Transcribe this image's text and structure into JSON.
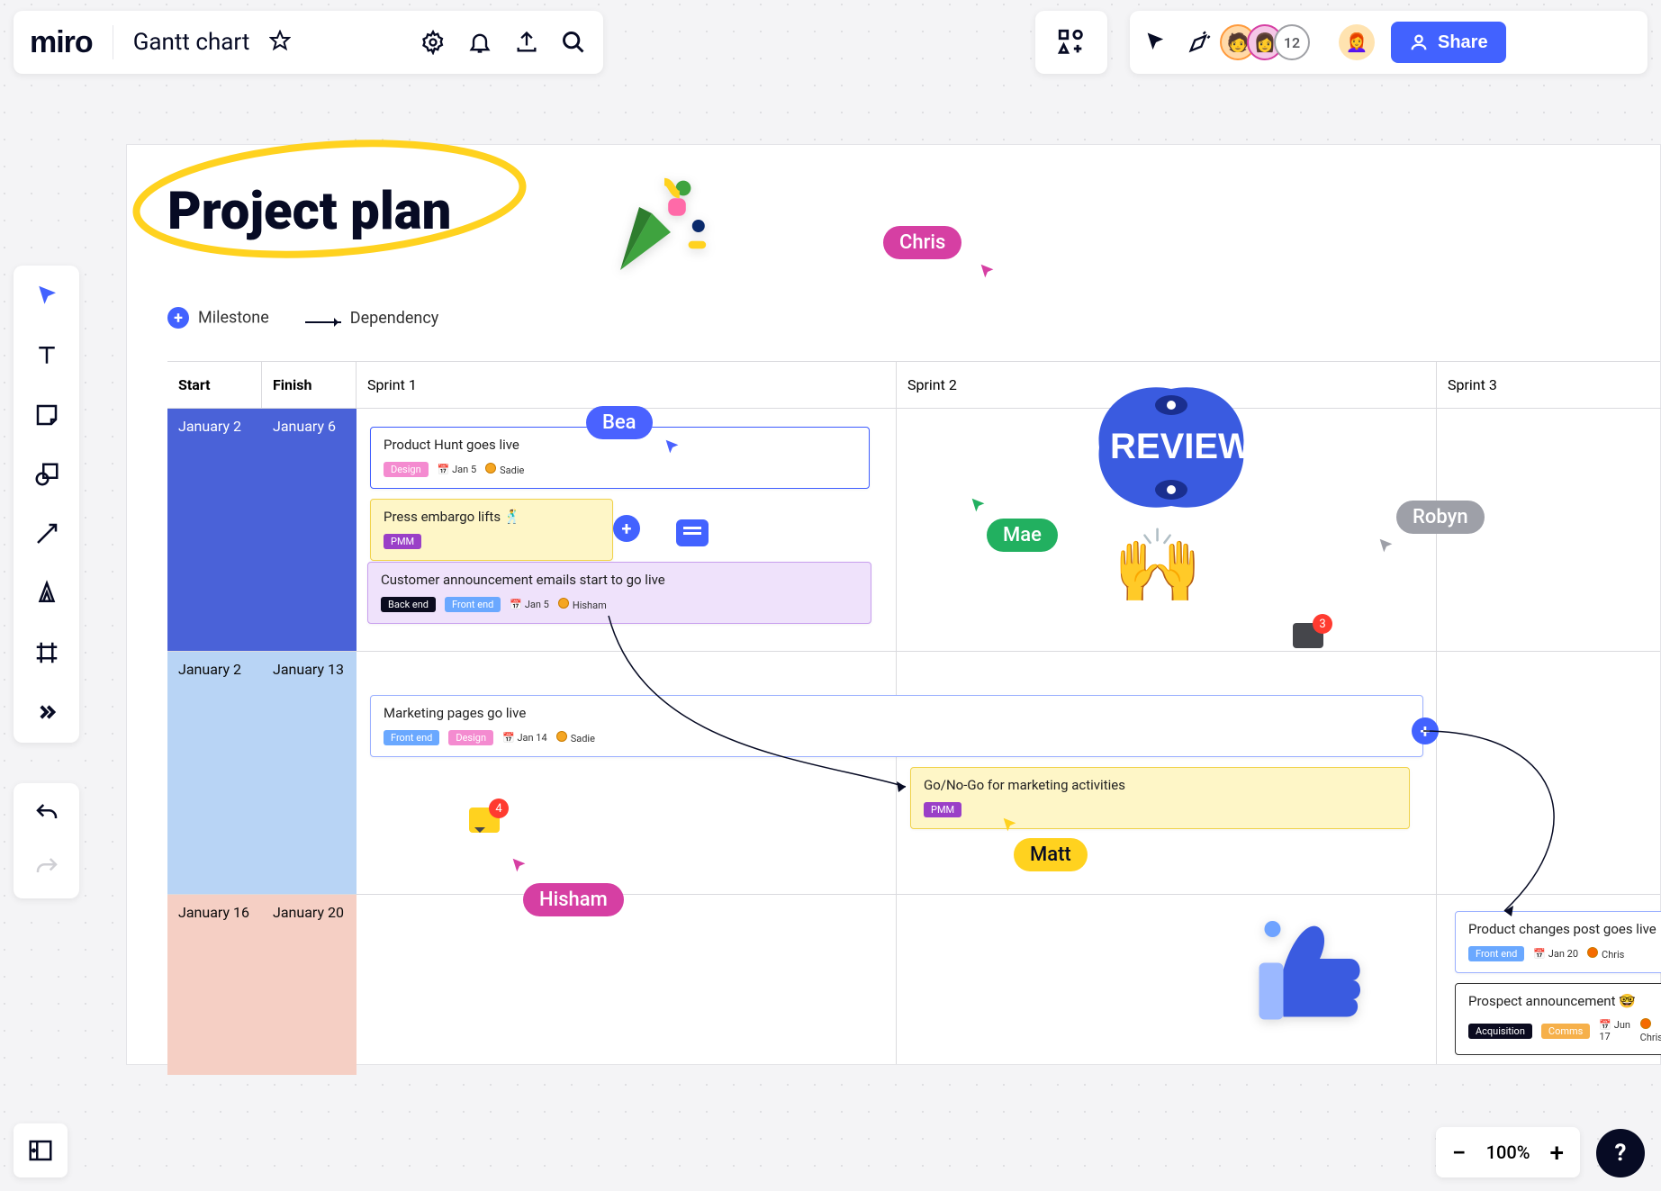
{
  "header": {
    "logo": "miro",
    "board_title": "Gantt chart",
    "avatar_overflow": "12",
    "share_label": "Share"
  },
  "zoom": {
    "level": "100%"
  },
  "canvas": {
    "title": "Project plan",
    "legend": {
      "milestone": "Milestone",
      "dependency": "Dependency"
    },
    "columns": {
      "start": "Start",
      "finish": "Finish",
      "sprint1": "Sprint 1",
      "sprint2": "Sprint 2",
      "sprint3": "Sprint 3"
    },
    "rows": [
      {
        "start": "January 2",
        "finish": "January 6"
      },
      {
        "start": "January 2",
        "finish": "January 13"
      },
      {
        "start": "January 16",
        "finish": "January 20"
      }
    ],
    "tasks": {
      "t1": {
        "title": "Product Hunt goes live",
        "tag1": "Design",
        "date": "Jan 5",
        "user": "Sadie"
      },
      "t2": {
        "title": "Press embargo lifts 🕺",
        "tag1": "PMM"
      },
      "t3": {
        "title": "Customer announcement emails start to go live",
        "tag1": "Back end",
        "tag2": "Front end",
        "date": "Jan 5",
        "user": "Hisham"
      },
      "t4": {
        "title": "Marketing pages go live",
        "tag1": "Front end",
        "tag2": "Design",
        "date": "Jan 14",
        "user": "Sadie"
      },
      "t5": {
        "title": "Go/No-Go for marketing activities",
        "tag1": "PMM"
      },
      "t6": {
        "title": "Product changes post goes live",
        "tag1": "Front end",
        "date": "Jan 20",
        "user": "Chris"
      },
      "t7": {
        "title": "Prospect announcement 🤓",
        "tag1": "Acquisition",
        "tag2": "Comms",
        "date": "Jun 17",
        "user": "Chris"
      }
    },
    "review_label": "REVIEW",
    "comment_counts": {
      "c1": "3",
      "c2": "4"
    },
    "cursors": {
      "chris": "Chris",
      "bea": "Bea",
      "mae": "Mae",
      "robyn": "Robyn",
      "matt": "Matt",
      "hisham": "Hisham"
    }
  },
  "help": "?"
}
